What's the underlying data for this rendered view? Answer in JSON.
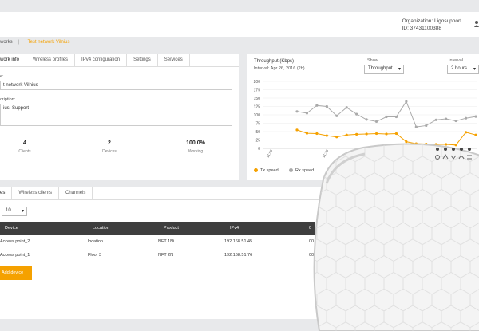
{
  "header": {
    "org_line1": "Organization: Ligosupport",
    "org_line2": "ID: 37431100388"
  },
  "breadcrumb": {
    "prev": "works",
    "separator": "|",
    "current": "Test network Vilnius"
  },
  "network_panel": {
    "tabs": [
      {
        "label": "work info",
        "active": true
      },
      {
        "label": "Wireless profiles",
        "active": false
      },
      {
        "label": "IPv4 configuration",
        "active": false
      },
      {
        "label": "Settings",
        "active": false
      },
      {
        "label": "Services",
        "active": false
      }
    ],
    "name_label": "e:",
    "name_value": "t network Vilnius",
    "desc_label": "cription:",
    "desc_value": "ius, Support",
    "stats": [
      {
        "value": "4",
        "label": "Clients"
      },
      {
        "value": "2",
        "label": "Devices"
      },
      {
        "value": "100.0%",
        "label": "Working"
      }
    ]
  },
  "throughput": {
    "title": "Throughput (Kbps)",
    "subtitle": "Interval: Apr 26, 2016 (2h)",
    "show_label": "Show",
    "show_value": "Throughput",
    "interval_label": "Interval",
    "interval_value": "2 hours",
    "legend_tx": "Tx speed",
    "legend_rx": "Rx speed",
    "colors": {
      "tx": "#f5a100",
      "rx": "#aaaaaa"
    }
  },
  "chart_data": {
    "type": "line",
    "ylim": [
      0,
      200
    ],
    "yticks": [
      0,
      25,
      50,
      75,
      100,
      125,
      150,
      175,
      200
    ],
    "xticks": [
      "11:00",
      "11:30",
      "12:00"
    ],
    "series": [
      {
        "name": "Rx speed",
        "values": [
          110,
          105,
          128,
          125,
          97,
          122,
          102,
          86,
          80,
          94,
          94,
          140,
          64,
          68,
          85,
          88,
          82,
          90,
          95
        ]
      },
      {
        "name": "Tx speed",
        "values": [
          55,
          45,
          44,
          38,
          34,
          40,
          42,
          43,
          44,
          43,
          44,
          20,
          14,
          13,
          12,
          12,
          10,
          48,
          40
        ]
      }
    ]
  },
  "devices_panel": {
    "tabs": [
      {
        "label": "es",
        "active": true
      },
      {
        "label": "Wireless clients",
        "active": false
      },
      {
        "label": "Channels",
        "active": false
      }
    ],
    "per_page": "10",
    "columns": [
      "Device",
      "Location",
      "Product",
      "IPv4",
      "0"
    ],
    "rows": [
      {
        "device": "Access point_2",
        "location": "location",
        "product": "NFT 1Ni",
        "ipv4": "192.168.51.45",
        "extra": "00"
      },
      {
        "device": "Access point_1",
        "location": "Floor 3",
        "product": "NFT 2N",
        "ipv4": "192.168.51.76",
        "extra": "00"
      }
    ],
    "add_label": "Add device"
  }
}
